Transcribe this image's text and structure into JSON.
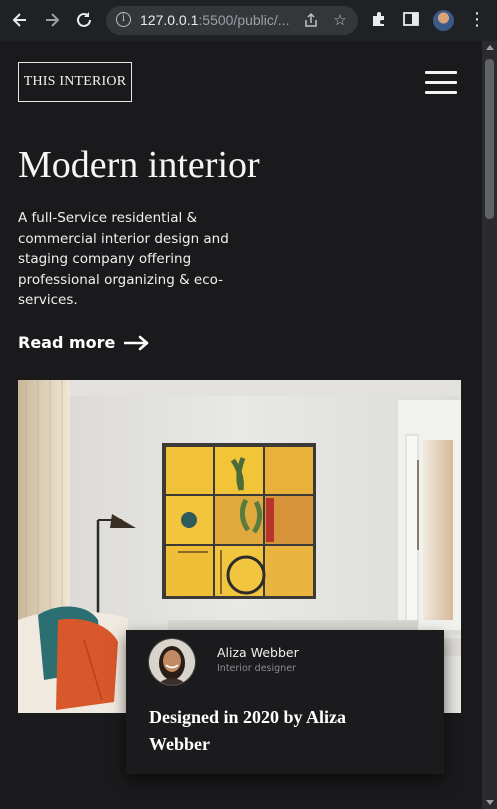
{
  "browser": {
    "url_host": "127.0.0.1",
    "url_rest": ":5500/public/...",
    "icons": [
      "back-arrow-icon",
      "forward-arrow-icon",
      "reload-icon",
      "info-icon",
      "share-icon",
      "star-icon",
      "extensions-icon",
      "side-panel-icon",
      "profile-avatar",
      "more-menu-icon"
    ]
  },
  "header": {
    "logo_text": "THIS INTERIOR",
    "menu_icon": "hamburger-icon"
  },
  "hero": {
    "title": "Modern interior",
    "description": "A full-Service residential & commercial interior design and staging company offering professional organizing & eco-services.",
    "cta_label": "Read more"
  },
  "designer_card": {
    "name": "Aliza Webber",
    "role": "Interior designer",
    "title": "Designed in 2020 by Aliza Webber"
  },
  "colors": {
    "background": "#1a1a1c",
    "text": "#f5f5f5",
    "muted": "#8a8a95",
    "chrome": "#202124"
  }
}
